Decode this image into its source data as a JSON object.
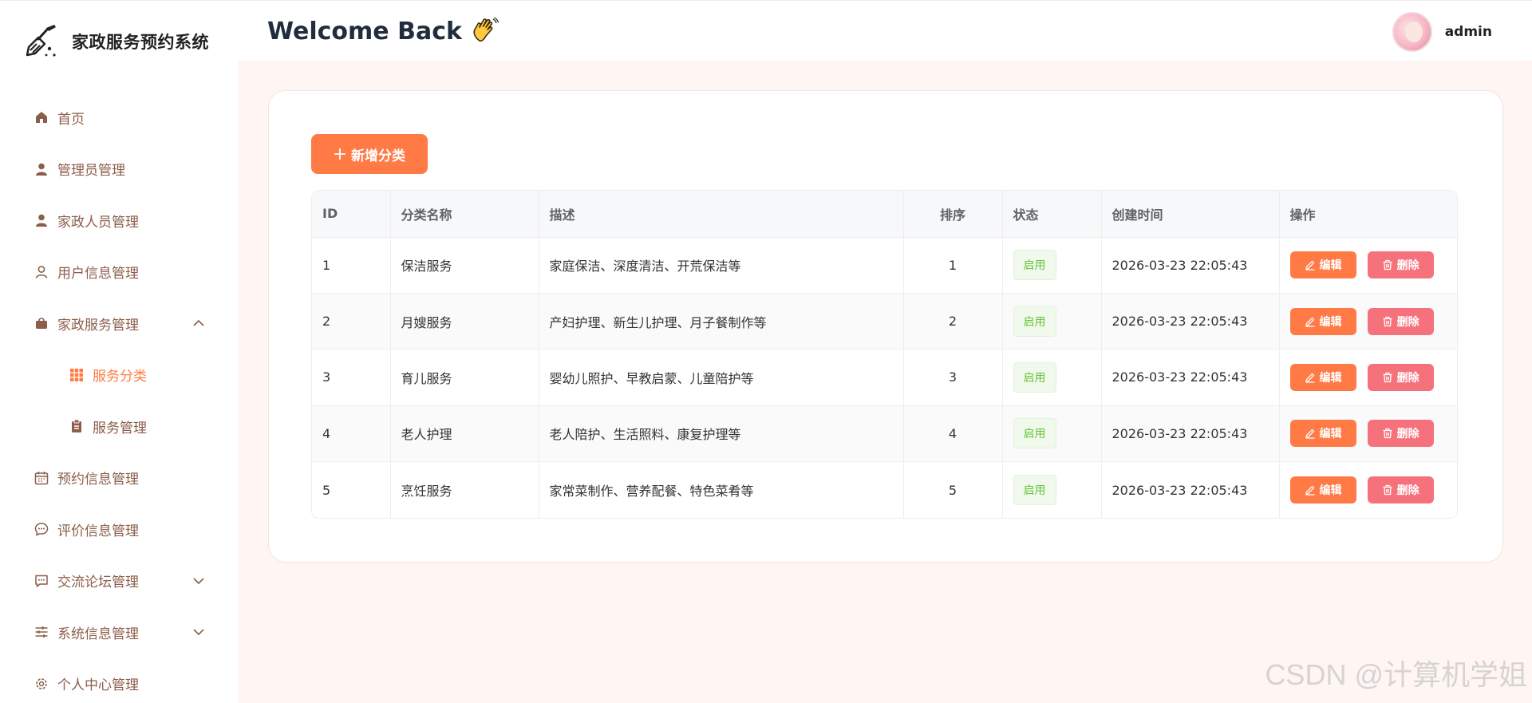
{
  "brand": {
    "title": "家政服务预约系统"
  },
  "header": {
    "welcome": "Welcome Back",
    "username": "admin"
  },
  "sidebar": {
    "items": [
      {
        "label": "首页",
        "icon": "home-icon"
      },
      {
        "label": "管理员管理",
        "icon": "user-icon"
      },
      {
        "label": "家政人员管理",
        "icon": "user-icon"
      },
      {
        "label": "用户信息管理",
        "icon": "user-outline-icon"
      },
      {
        "label": "家政服务管理",
        "icon": "bag-icon",
        "expanded": true
      },
      {
        "label": "服务分类",
        "icon": "grid-icon",
        "active": true,
        "sub": true
      },
      {
        "label": "服务管理",
        "icon": "clipboard-icon",
        "sub": true
      },
      {
        "label": "预约信息管理",
        "icon": "calendar-icon"
      },
      {
        "label": "评价信息管理",
        "icon": "chat-icon"
      },
      {
        "label": "交流论坛管理",
        "icon": "message-icon",
        "collapsed": true
      },
      {
        "label": "系统信息管理",
        "icon": "sliders-icon",
        "collapsed": true
      },
      {
        "label": "个人中心管理",
        "icon": "gear-icon"
      }
    ]
  },
  "toolbar": {
    "add_label": "新增分类"
  },
  "table": {
    "headers": {
      "id": "ID",
      "name": "分类名称",
      "desc": "描述",
      "sort": "排序",
      "status": "状态",
      "created": "创建时间",
      "ops": "操作"
    },
    "rows": [
      {
        "id": "1",
        "name": "保洁服务",
        "desc": "家庭保洁、深度清洁、开荒保洁等",
        "sort": "1",
        "status": "启用",
        "created": "2026-03-23 22:05:43"
      },
      {
        "id": "2",
        "name": "月嫂服务",
        "desc": "产妇护理、新生儿护理、月子餐制作等",
        "sort": "2",
        "status": "启用",
        "created": "2026-03-23 22:05:43"
      },
      {
        "id": "3",
        "name": "育儿服务",
        "desc": "婴幼儿照护、早教启蒙、儿童陪护等",
        "sort": "3",
        "status": "启用",
        "created": "2026-03-23 22:05:43"
      },
      {
        "id": "4",
        "name": "老人护理",
        "desc": "老人陪护、生活照料、康复护理等",
        "sort": "4",
        "status": "启用",
        "created": "2026-03-23 22:05:43"
      },
      {
        "id": "5",
        "name": "烹饪服务",
        "desc": "家常菜制作、营养配餐、特色菜肴等",
        "sort": "5",
        "status": "启用",
        "created": "2026-03-23 22:05:43"
      }
    ],
    "edit_label": "编辑",
    "delete_label": "删除"
  },
  "watermark": "CSDN @计算机学姐",
  "colors": {
    "accent": "#ff7a45",
    "danger": "#f5727c",
    "success": "#67c23a",
    "sidebar_text": "#8b5e4a"
  }
}
